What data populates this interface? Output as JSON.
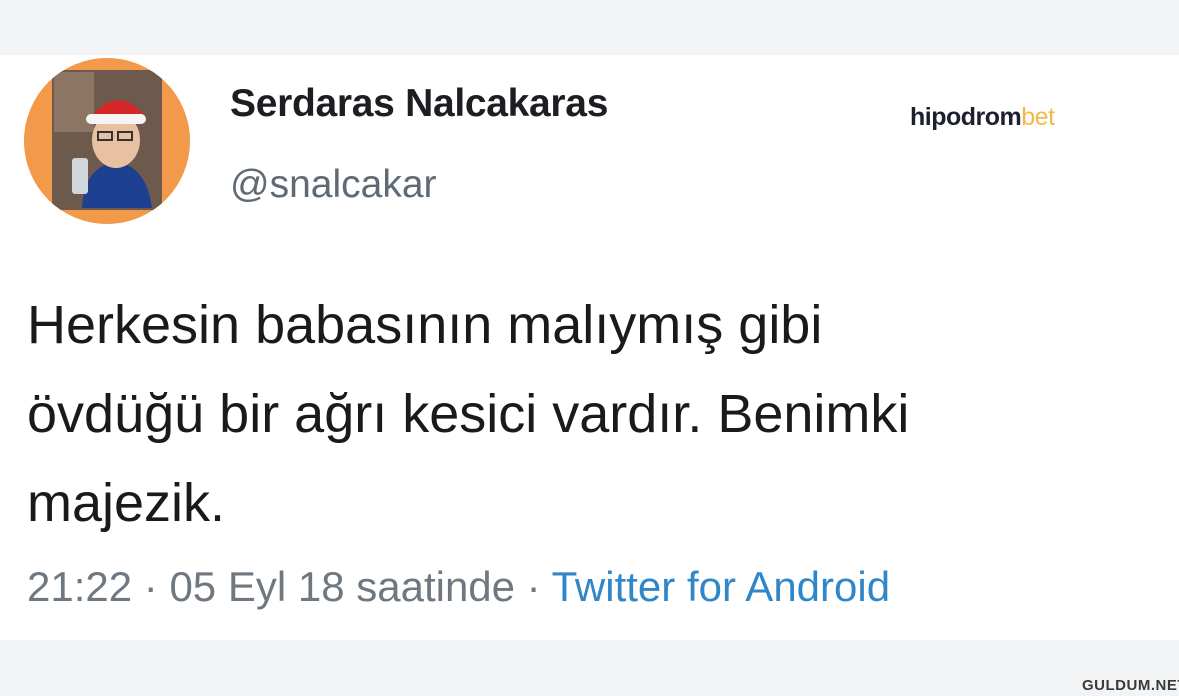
{
  "tweet": {
    "display_name": "Serdaras Nalcakaras",
    "handle": "@snalcakar",
    "text_lines": [
      "Herkesin babasının malıymış gibi",
      "övdüğü bir ağrı kesici vardır. Benimki",
      "majezik."
    ],
    "time": "21:22",
    "separator": " · ",
    "date": "05 Eyl 18 saatinde",
    "source": "Twitter for Android"
  },
  "brand": {
    "part1": "hipodrom",
    "part2": "bet"
  },
  "watermark": "GULDUM.NET",
  "colors": {
    "avatar_bg": "#f2994a",
    "link": "#2f86c9",
    "meta_text": "#6f7780",
    "brand_accent": "#f3b84a"
  },
  "icons": {
    "avatar": "user-photo"
  }
}
